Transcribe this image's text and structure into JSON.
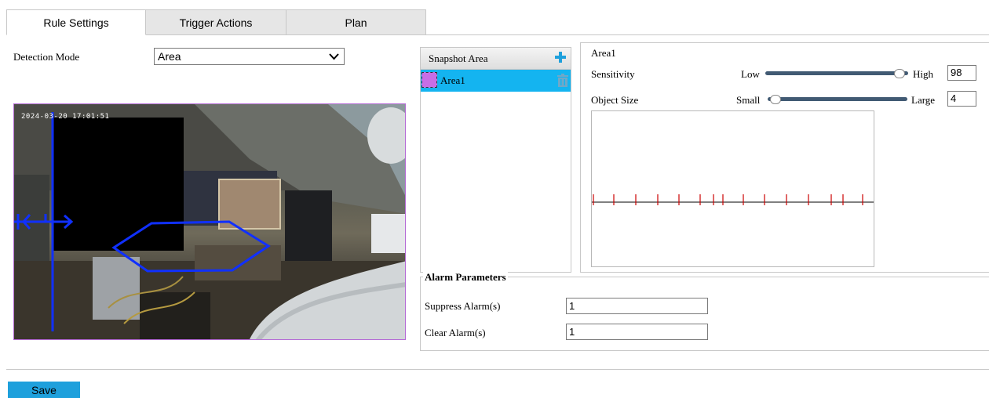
{
  "tabs": [
    {
      "label": "Rule Settings",
      "active": true
    },
    {
      "label": "Trigger Actions",
      "active": false
    },
    {
      "label": "Plan",
      "active": false
    }
  ],
  "detection": {
    "label": "Detection Mode",
    "value": "Area"
  },
  "video": {
    "timestamp": "2024-03-20 17:01:51"
  },
  "snapshot": {
    "header": "Snapshot Area",
    "items": [
      {
        "label": "Area1",
        "color": "#c86ee6"
      }
    ]
  },
  "area_settings": {
    "title": "Area1",
    "sensitivity": {
      "label": "Sensitivity",
      "low": "Low",
      "high": "High",
      "value": "98",
      "fraction": 0.98
    },
    "object_size": {
      "label": "Object Size",
      "small": "Small",
      "large": "Large",
      "value": "4",
      "fraction": 0.04
    }
  },
  "alarm": {
    "legend": "Alarm Parameters",
    "suppress_label": "Suppress Alarm(s)",
    "suppress_value": "1",
    "clear_label": "Clear Alarm(s)",
    "clear_value": "1"
  },
  "save_label": "Save",
  "colors": {
    "accent": "#14b4f0",
    "save_button": "#1ea0dc",
    "slider": "#415a73",
    "area_color": "#c86ee6",
    "plus_icon": "#1ea0dc",
    "trash_icon": "#6fa8c8",
    "motion_tick": "#cc0000",
    "overlay_line": "#1030ff"
  }
}
